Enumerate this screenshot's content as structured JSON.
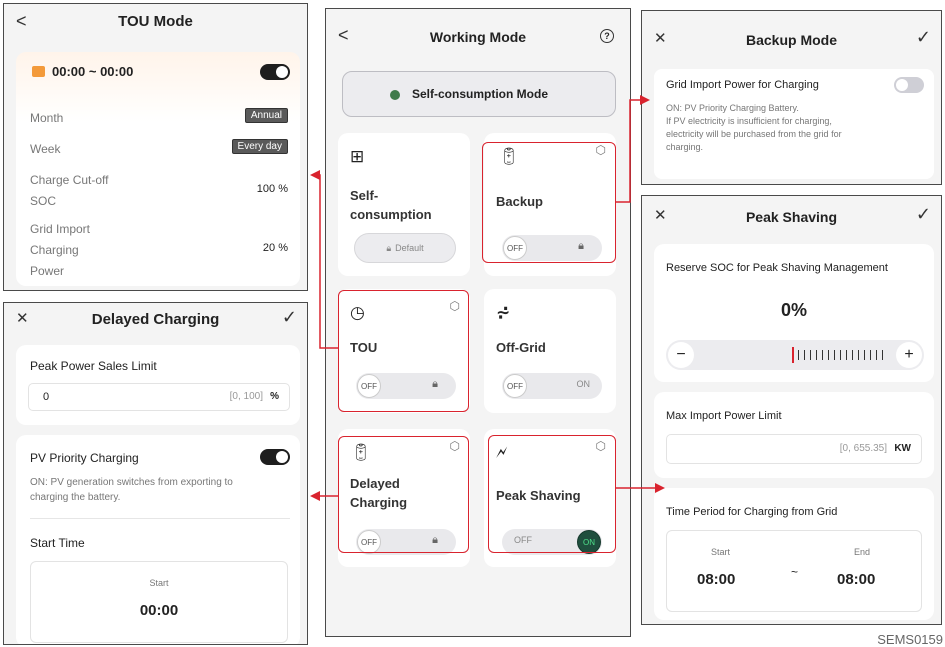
{
  "tou": {
    "title": "TOU Mode",
    "back": "<",
    "time_range": "00:00 ~ 00:00",
    "month_label": "Month",
    "month_value": "Annual",
    "week_label": "Week",
    "week_value": "Every day",
    "charge_cutoff_label_1": "Charge Cut-off",
    "charge_cutoff_label_2": "SOC",
    "charge_cutoff_value": "100 %",
    "grid_import_label_1": "Grid Import",
    "grid_import_label_2": "Charging",
    "grid_import_label_3": "Power",
    "grid_import_value": "20 %"
  },
  "delayed": {
    "title": "Delayed Charging",
    "close": "✕",
    "confirm": "✓",
    "peak_power_label": "Peak Power Sales Limit",
    "peak_power_value": "0",
    "peak_power_range": "[0, 100]",
    "peak_power_unit": "%",
    "pv_label": "PV Priority Charging",
    "pv_desc_1": "ON: PV generation switches from exporting to",
    "pv_desc_2": "charging the battery.",
    "start_time_label": "Start Time",
    "start_label": "Start",
    "start_value": "00:00"
  },
  "working": {
    "title": "Working Mode",
    "back": "<",
    "help": "?",
    "current_mode": "Self-consumption Mode",
    "self_title_1": "Self-",
    "self_title_2": "consumption",
    "default_label": "Default",
    "backup_title": "Backup",
    "tou_title": "TOU",
    "offgrid_title": "Off-Grid",
    "delayed_title_1": "Delayed",
    "delayed_title_2": "Charging",
    "peak_title": "Peak Shaving",
    "off": "OFF",
    "on": "ON"
  },
  "backup": {
    "title": "Backup Mode",
    "close": "✕",
    "confirm": "✓",
    "grid_import_label": "Grid Import Power for Charging",
    "desc_1": "ON: PV Priority Charging Battery.",
    "desc_2": "If PV electricity is insufficient for charging,",
    "desc_3": "electricity will be purchased from the grid for",
    "desc_4": "charging."
  },
  "peak": {
    "title": "Peak Shaving",
    "close": "✕",
    "confirm": "✓",
    "reserve_label": "Reserve SOC for Peak Shaving Management",
    "reserve_value": "0%",
    "minus": "−",
    "plus": "+",
    "max_import_label": "Max Import Power Limit",
    "max_import_range": "[0, 655.35]",
    "max_import_unit": "KW",
    "time_period_label": "Time Period for Charging from Grid",
    "start_label": "Start",
    "end_label": "End",
    "start_value": "08:00",
    "end_value": "08:00",
    "separator": "~"
  },
  "footer_code": "SEMS0159",
  "colors": {
    "accent_red": "#d9232e",
    "toggle_on": "#1e1e1e",
    "on_green": "#4fe08a"
  }
}
